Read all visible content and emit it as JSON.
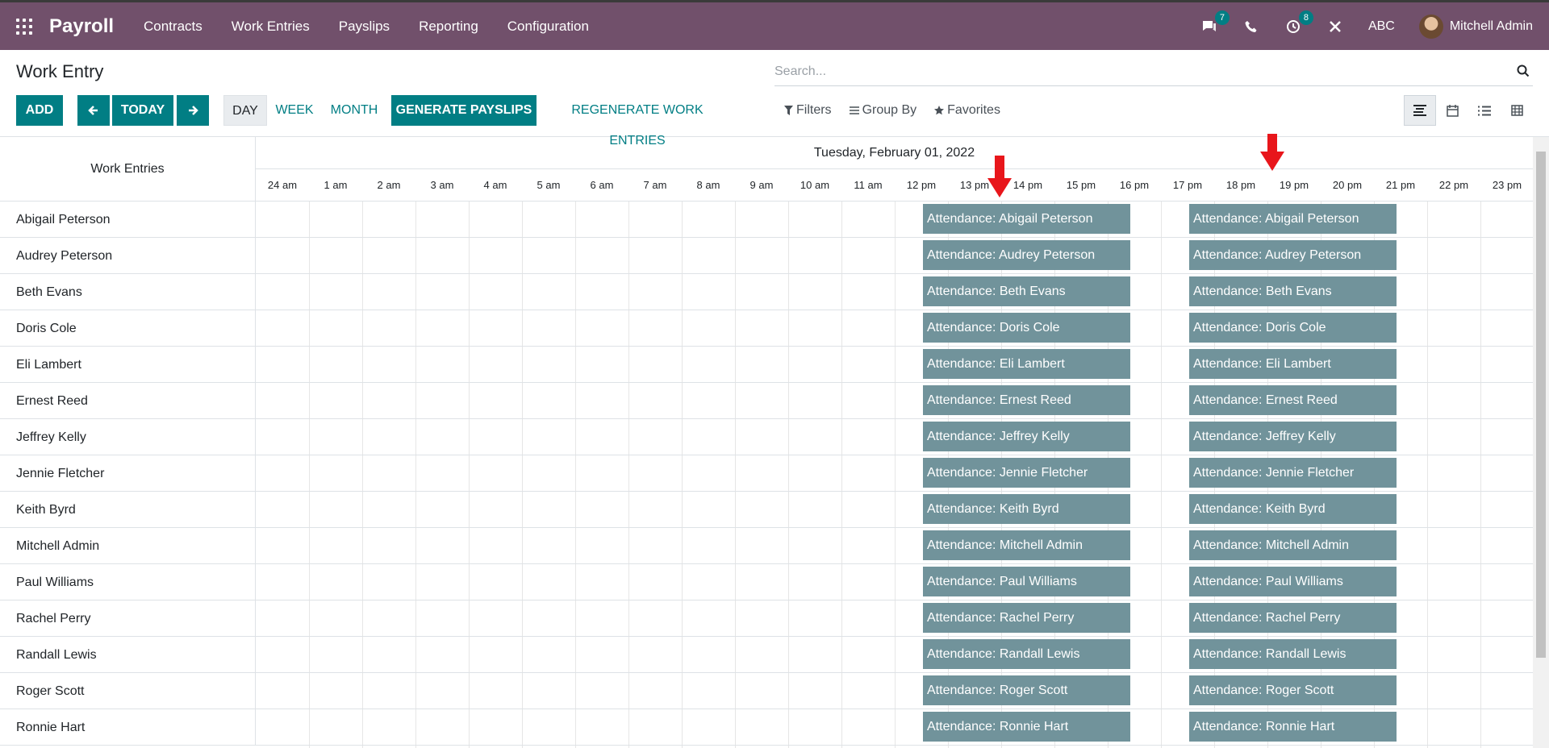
{
  "app": {
    "name": "Payroll"
  },
  "topnav": [
    {
      "label": "Contracts",
      "name": "nav-contracts"
    },
    {
      "label": "Work Entries",
      "name": "nav-work-entries"
    },
    {
      "label": "Payslips",
      "name": "nav-payslips"
    },
    {
      "label": "Reporting",
      "name": "nav-reporting"
    },
    {
      "label": "Configuration",
      "name": "nav-configuration"
    }
  ],
  "systray": {
    "messages_count": "7",
    "activities_count": "8",
    "company": "ABC",
    "user": "Mitchell Admin"
  },
  "page": {
    "title": "Work Entry"
  },
  "search": {
    "placeholder": "Search..."
  },
  "buttons": {
    "add": "ADD",
    "today": "TODAY",
    "day": "DAY",
    "week": "WEEK",
    "month": "MONTH",
    "generate": "GENERATE PAYSLIPS",
    "regenerate": "REGENERATE WORK ENTRIES"
  },
  "filters": {
    "filters": "Filters",
    "group_by": "Group By",
    "favorites": "Favorites"
  },
  "gantt": {
    "header_left": "Work Entries",
    "date": "Tuesday, February 01, 2022",
    "hours": [
      "24 am",
      "1 am",
      "2 am",
      "3 am",
      "4 am",
      "5 am",
      "6 am",
      "7 am",
      "8 am",
      "9 am",
      "10 am",
      "11 am",
      "12 pm",
      "13 pm",
      "14 pm",
      "15 pm",
      "16 pm",
      "17 pm",
      "18 pm",
      "19 pm",
      "20 pm",
      "21 pm",
      "22 pm",
      "23 pm"
    ],
    "rows": [
      {
        "name": "Abigail Peterson",
        "entries": [
          "Attendance: Abigail Peterson",
          "Attendance: Abigail Peterson"
        ]
      },
      {
        "name": "Audrey Peterson",
        "entries": [
          "Attendance: Audrey Peterson",
          "Attendance: Audrey Peterson"
        ]
      },
      {
        "name": "Beth Evans",
        "entries": [
          "Attendance: Beth Evans",
          "Attendance: Beth Evans"
        ]
      },
      {
        "name": "Doris Cole",
        "entries": [
          "Attendance: Doris Cole",
          "Attendance: Doris Cole"
        ]
      },
      {
        "name": "Eli Lambert",
        "entries": [
          "Attendance: Eli Lambert",
          "Attendance: Eli Lambert"
        ]
      },
      {
        "name": "Ernest Reed",
        "entries": [
          "Attendance: Ernest Reed",
          "Attendance: Ernest Reed"
        ]
      },
      {
        "name": "Jeffrey Kelly",
        "entries": [
          "Attendance: Jeffrey Kelly",
          "Attendance: Jeffrey Kelly"
        ]
      },
      {
        "name": "Jennie Fletcher",
        "entries": [
          "Attendance: Jennie Fletcher",
          "Attendance: Jennie Fletcher"
        ]
      },
      {
        "name": "Keith Byrd",
        "entries": [
          "Attendance: Keith Byrd",
          "Attendance: Keith Byrd"
        ]
      },
      {
        "name": "Mitchell Admin",
        "entries": [
          "Attendance: Mitchell Admin",
          "Attendance: Mitchell Admin"
        ]
      },
      {
        "name": "Paul Williams",
        "entries": [
          "Attendance: Paul Williams",
          "Attendance: Paul Williams"
        ]
      },
      {
        "name": "Rachel Perry",
        "entries": [
          "Attendance: Rachel Perry",
          "Attendance: Rachel Perry"
        ]
      },
      {
        "name": "Randall Lewis",
        "entries": [
          "Attendance: Randall Lewis",
          "Attendance: Randall Lewis"
        ]
      },
      {
        "name": "Roger Scott",
        "entries": [
          "Attendance: Roger Scott",
          "Attendance: Roger Scott"
        ]
      },
      {
        "name": "Ronnie Hart",
        "entries": [
          "Attendance: Ronnie Hart",
          "Attendance: Ronnie Hart"
        ]
      }
    ]
  },
  "colors": {
    "navbar": "#71506b",
    "primary": "#017e84",
    "pill": "#71939b",
    "annotation_arrow": "#e8161b"
  }
}
